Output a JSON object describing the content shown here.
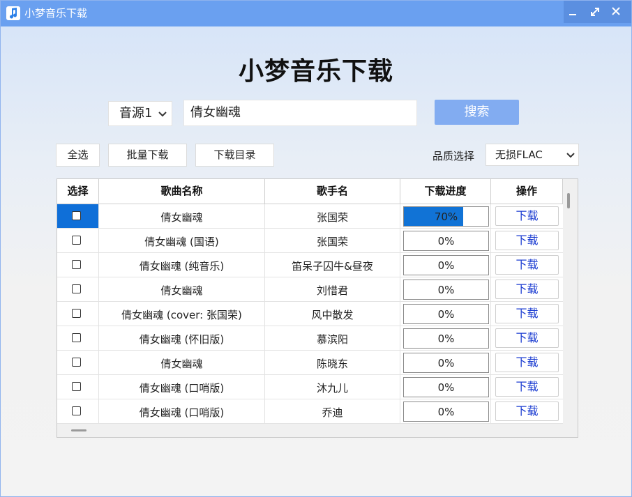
{
  "window": {
    "title": "小梦音乐下载"
  },
  "heading": "小梦音乐下载",
  "search": {
    "source": "音源1",
    "query": "倩女幽魂",
    "button": "搜索"
  },
  "toolbar": {
    "select_all": "全选",
    "batch_download": "批量下载",
    "download_dir": "下载目录",
    "quality_label": "品质选择",
    "quality_value": "无损FLAC"
  },
  "table": {
    "headers": [
      "选择",
      "歌曲名称",
      "歌手名",
      "下载进度",
      "操作"
    ],
    "rows": [
      {
        "song": "倩女幽魂",
        "artist": "张国荣",
        "progress": "70%",
        "progress_value": 0.7,
        "action": "下载",
        "selected": true
      },
      {
        "song": "倩女幽魂 (国语)",
        "artist": "张国荣",
        "progress": "0%",
        "progress_value": 0,
        "action": "下载",
        "selected": false
      },
      {
        "song": "倩女幽魂 (纯音乐)",
        "artist": "笛呆子囚牛&昼夜",
        "progress": "0%",
        "progress_value": 0,
        "action": "下载",
        "selected": false
      },
      {
        "song": "倩女幽魂",
        "artist": "刘惜君",
        "progress": "0%",
        "progress_value": 0,
        "action": "下载",
        "selected": false
      },
      {
        "song": "倩女幽魂 (cover: 张国荣)",
        "artist": "风中散发",
        "progress": "0%",
        "progress_value": 0,
        "action": "下载",
        "selected": false
      },
      {
        "song": "倩女幽魂 (怀旧版)",
        "artist": "慕滨阳",
        "progress": "0%",
        "progress_value": 0,
        "action": "下载",
        "selected": false
      },
      {
        "song": "倩女幽魂",
        "artist": "陈晓东",
        "progress": "0%",
        "progress_value": 0,
        "action": "下载",
        "selected": false
      },
      {
        "song": "倩女幽魂 (口哨版)",
        "artist": "沐九儿",
        "progress": "0%",
        "progress_value": 0,
        "action": "下载",
        "selected": false
      },
      {
        "song": "倩女幽魂 (口哨版)",
        "artist": "乔迪",
        "progress": "0%",
        "progress_value": 0,
        "action": "下载",
        "selected": false
      }
    ]
  },
  "colors": {
    "titlebar": "#6aa0f0",
    "accent": "#1173d6",
    "search_button": "#82acf1",
    "link": "#1a3bd1"
  }
}
